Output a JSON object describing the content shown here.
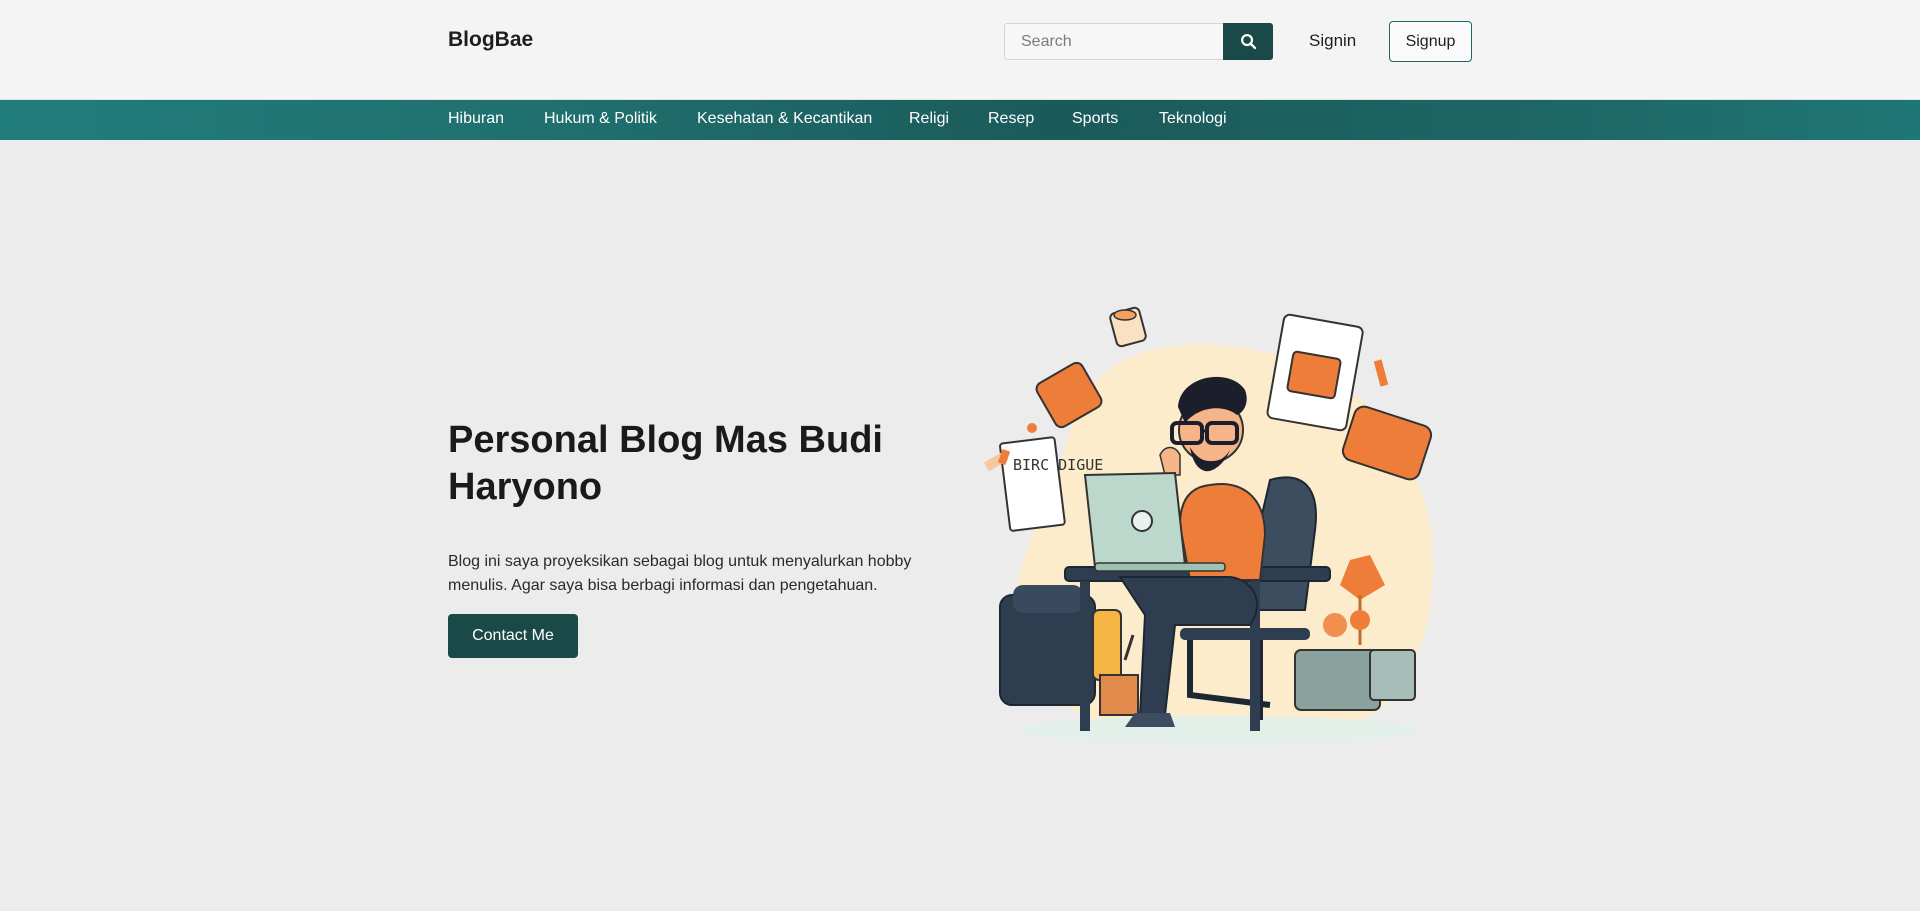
{
  "header": {
    "brand": "BlogBae",
    "search": {
      "placeholder": "Search",
      "value": ""
    },
    "search_icon": "search-icon",
    "signin_label": "Signin",
    "signup_label": "Signup"
  },
  "nav": {
    "items": [
      {
        "label": "Hiburan"
      },
      {
        "label": "Hukum & Politik"
      },
      {
        "label": "Kesehatan & Kecantikan"
      },
      {
        "label": "Religi"
      },
      {
        "label": "Resep"
      },
      {
        "label": "Sports"
      },
      {
        "label": "Teknologi"
      }
    ]
  },
  "hero": {
    "title": "Personal Blog Mas Budi Haryono",
    "description": "Blog ini saya proyeksikan sebagai blog untuk menyalurkan hobby menulis. Agar saya bisa berbagi informasi dan pengetahuan.",
    "cta_label": "Contact Me",
    "illustration_note": "BIRC DIGUE"
  },
  "colors": {
    "accent": "#1a4a47",
    "nav": "#1f6f6e",
    "orange": "#ee7d3a",
    "laptop": "#bcd7cc"
  }
}
